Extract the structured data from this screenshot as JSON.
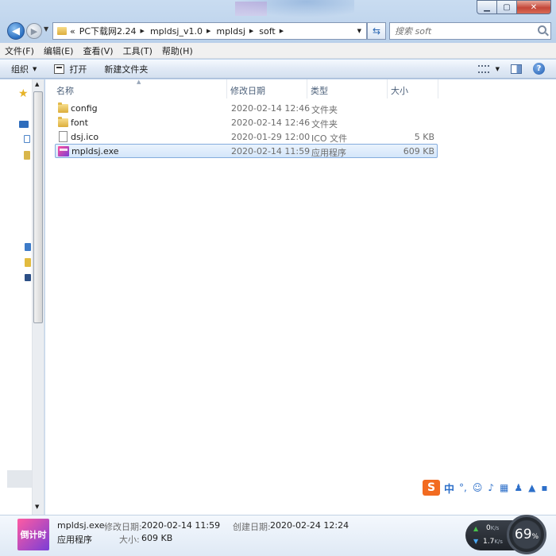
{
  "window": {
    "controls": {
      "minimize": "▁",
      "maximize": "▢",
      "close": "✕"
    }
  },
  "nav": {
    "address_parts": [
      "«",
      "PC下载网2.24",
      "mpldsj_v1.0",
      "mpldsj",
      "soft"
    ],
    "search_placeholder": "搜索 soft"
  },
  "menu": {
    "items": [
      "文件(F)",
      "编辑(E)",
      "查看(V)",
      "工具(T)",
      "帮助(H)"
    ]
  },
  "toolbar": {
    "organize": "组织",
    "open": "打开",
    "new_folder": "新建文件夹"
  },
  "columns": {
    "name": "名称",
    "date": "修改日期",
    "type": "类型",
    "size": "大小"
  },
  "files": [
    {
      "name": "config",
      "date": "2020-02-14 12:46",
      "type": "文件夹",
      "size": "",
      "icon": "folder-icon"
    },
    {
      "name": "font",
      "date": "2020-02-14 12:46",
      "type": "文件夹",
      "size": "",
      "icon": "folder-icon"
    },
    {
      "name": "dsj.ico",
      "date": "2020-01-29 12:00",
      "type": "ICO 文件",
      "size": "5 KB",
      "icon": "ico-file-icon"
    },
    {
      "name": "mpldsj.exe",
      "date": "2020-02-14 11:59",
      "type": "应用程序",
      "size": "609 KB",
      "icon": "exe-icon",
      "selected": true
    }
  ],
  "details": {
    "thumb_text": "倒计时",
    "name": "mpldsj.exe",
    "type": "应用程序",
    "modified_label": "修改日期:",
    "modified_value": "2020-02-14 11:59",
    "size_label": "大小:",
    "size_value": "609 KB",
    "created_label": "创建日期:",
    "created_value": "2020-02-24 12:24"
  },
  "ime": {
    "logo": "S",
    "mode": "中"
  },
  "netmon": {
    "up_value": "0",
    "up_unit": "K/s",
    "down_value": "1.7",
    "down_unit": "K/s",
    "gauge_value": "69",
    "gauge_unit": "%"
  },
  "colors": {
    "accent": "#2a6fc1",
    "selection": "#d4e6fa",
    "ime_orange": "#f26b21"
  }
}
